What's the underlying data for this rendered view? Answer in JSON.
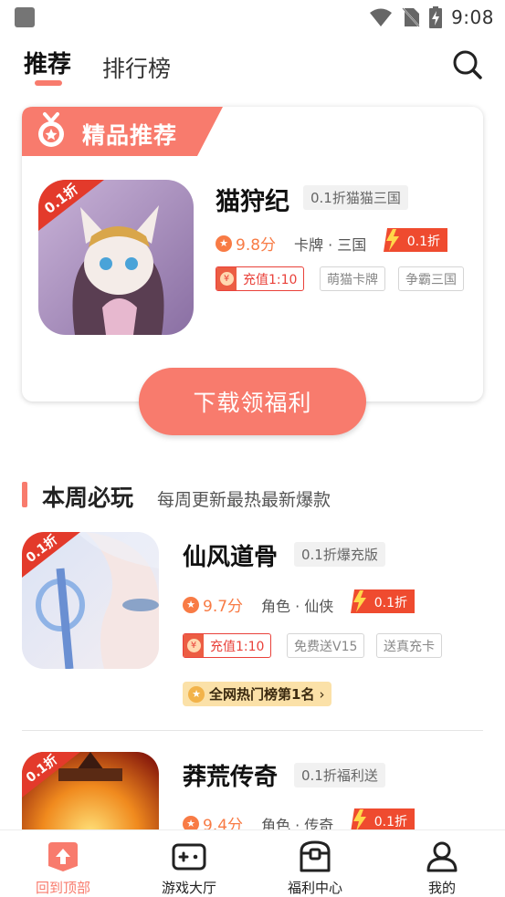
{
  "status_bar": {
    "time": "9:08"
  },
  "top_tabs": {
    "recommend": "推荐",
    "rank": "排行榜"
  },
  "featured": {
    "banner_title": "精品推荐",
    "game": {
      "name": "猫狩纪",
      "tag": "0.1折猫猫三国",
      "icon_badge": "0.1折",
      "rating": "9.8分",
      "category": "卡牌 · 三国",
      "discount": "0.1折",
      "recharge": "充值1:10",
      "extra_tags": [
        "萌猫卡牌",
        "争霸三国"
      ]
    },
    "download_label": "下载领福利"
  },
  "weekly": {
    "title": "本周必玩",
    "subtitle": "每周更新最热最新爆款",
    "games": [
      {
        "name": "仙风道骨",
        "tag": "0.1折爆充版",
        "icon_badge": "0.1折",
        "rating": "9.7分",
        "category": "角色 · 仙侠",
        "discount": "0.1折",
        "recharge": "充值1:10",
        "extra_tags": [
          "免费送V15",
          "送真充卡"
        ],
        "rank_label": "全网热门榜第1名"
      },
      {
        "name": "莽荒传奇",
        "tag": "0.1折福利送",
        "icon_badge": "0.1折",
        "rating": "9.4分",
        "category": "角色 · 传奇",
        "discount": "0.1折"
      }
    ]
  },
  "bottom_nav": [
    {
      "label": "回到顶部",
      "icon": "arrow-up-icon",
      "active": true
    },
    {
      "label": "游戏大厅",
      "icon": "gamepad-icon",
      "active": false
    },
    {
      "label": "福利中心",
      "icon": "treasure-chest-icon",
      "active": false
    },
    {
      "label": "我的",
      "icon": "user-icon",
      "active": false
    }
  ],
  "colors": {
    "accent": "#f87b6d",
    "rating": "#f87b45",
    "recharge": "#e9413a"
  }
}
